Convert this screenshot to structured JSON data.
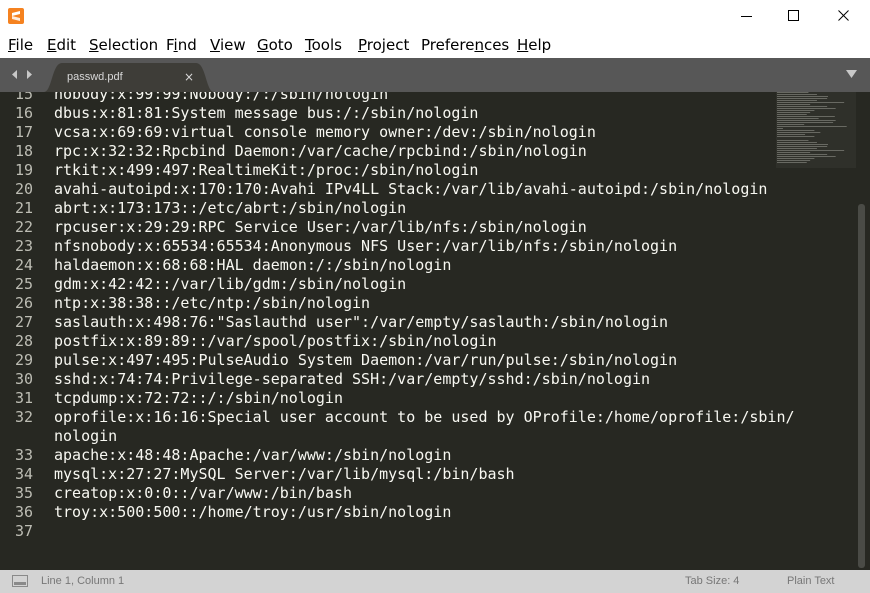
{
  "window": {
    "app_icon": "sublime-text-icon",
    "controls": [
      "minimize-icon",
      "maximize-icon",
      "close-icon"
    ]
  },
  "menu": [
    {
      "name": "file",
      "label": "File",
      "mnemonic": "F"
    },
    {
      "name": "edit",
      "label": "Edit",
      "mnemonic": "E"
    },
    {
      "name": "selection",
      "label": "Selection",
      "mnemonic": "S"
    },
    {
      "name": "find",
      "label": "Find",
      "mnemonic": "i"
    },
    {
      "name": "view",
      "label": "View",
      "mnemonic": "V"
    },
    {
      "name": "goto",
      "label": "Goto",
      "mnemonic": "G"
    },
    {
      "name": "tools",
      "label": "Tools",
      "mnemonic": "T"
    },
    {
      "name": "project",
      "label": "Project",
      "mnemonic": "P"
    },
    {
      "name": "preferences",
      "label": "Preferences",
      "mnemonic": "n"
    },
    {
      "name": "help",
      "label": "Help",
      "mnemonic": "H"
    }
  ],
  "tabs": {
    "active": {
      "label": "passwd.pdf",
      "close_glyph": "×"
    }
  },
  "editor": {
    "lines": [
      {
        "num": "15",
        "text": "nobody:x:99:99:Nobody:/:/sbin/nologin"
      },
      {
        "num": "16",
        "text": "dbus:x:81:81:System message bus:/:/sbin/nologin"
      },
      {
        "num": "17",
        "text": "vcsa:x:69:69:virtual console memory owner:/dev:/sbin/nologin"
      },
      {
        "num": "18",
        "text": "rpc:x:32:32:Rpcbind Daemon:/var/cache/rpcbind:/sbin/nologin"
      },
      {
        "num": "19",
        "text": "rtkit:x:499:497:RealtimeKit:/proc:/sbin/nologin"
      },
      {
        "num": "20",
        "text": "avahi-autoipd:x:170:170:Avahi IPv4LL Stack:/var/lib/avahi-autoipd:/sbin/nologin"
      },
      {
        "num": "21",
        "text": "abrt:x:173:173::/etc/abrt:/sbin/nologin"
      },
      {
        "num": "22",
        "text": "rpcuser:x:29:29:RPC Service User:/var/lib/nfs:/sbin/nologin"
      },
      {
        "num": "23",
        "text": "nfsnobody:x:65534:65534:Anonymous NFS User:/var/lib/nfs:/sbin/nologin"
      },
      {
        "num": "24",
        "text": "haldaemon:x:68:68:HAL daemon:/:/sbin/nologin"
      },
      {
        "num": "25",
        "text": "gdm:x:42:42::/var/lib/gdm:/sbin/nologin"
      },
      {
        "num": "26",
        "text": "ntp:x:38:38::/etc/ntp:/sbin/nologin"
      },
      {
        "num": "27",
        "text": "saslauth:x:498:76:\"Saslauthd user\":/var/empty/saslauth:/sbin/nologin"
      },
      {
        "num": "28",
        "text": "postfix:x:89:89::/var/spool/postfix:/sbin/nologin"
      },
      {
        "num": "29",
        "text": "pulse:x:497:495:PulseAudio System Daemon:/var/run/pulse:/sbin/nologin"
      },
      {
        "num": "30",
        "text": "sshd:x:74:74:Privilege-separated SSH:/var/empty/sshd:/sbin/nologin"
      },
      {
        "num": "31",
        "text": "tcpdump:x:72:72::/:/sbin/nologin"
      },
      {
        "num": "32",
        "text": "oprofile:x:16:16:Special user account to be used by OProfile:/home/oprofile:/sbin/"
      },
      {
        "num": "",
        "text": "nologin"
      },
      {
        "num": "33",
        "text": "apache:x:48:48:Apache:/var/www:/sbin/nologin"
      },
      {
        "num": "34",
        "text": "mysql:x:27:27:MySQL Server:/var/lib/mysql:/bin/bash"
      },
      {
        "num": "35",
        "text": "creatop:x:0:0::/var/www:/bin/bash"
      },
      {
        "num": "36",
        "text": "troy:x:500:500::/home/troy:/usr/sbin/nologin"
      },
      {
        "num": "37",
        "text": ""
      }
    ]
  },
  "statusbar": {
    "panel_icon": "panel-toggle-icon",
    "position": "Line 1, Column 1",
    "tab_size": "Tab Size: 4",
    "syntax": "Plain Text"
  },
  "colors": {
    "editor_bg": "#272822",
    "editor_text": "#f8f8f2",
    "gutter_text": "#bdbdb4",
    "tabbar_bg": "#575757",
    "tab_active_bg": "#3e3d38",
    "statusbar_bg": "#d3d3d3",
    "accent": "#f58220"
  }
}
